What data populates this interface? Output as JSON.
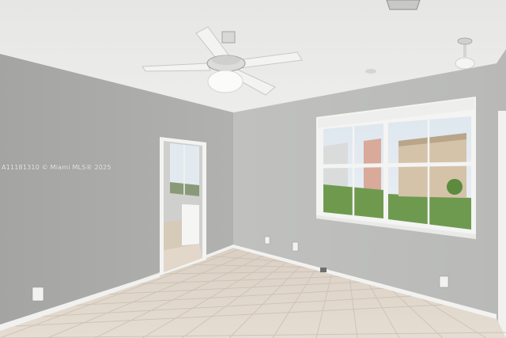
{
  "photo": {
    "watermark_text": "A11181310 © Miami MLS® 2025"
  },
  "colors": {
    "ceiling": "#e9e9e7",
    "left_wall": "#a9aaa8",
    "back_wall": "#c3c4c2",
    "right_wall": "#b5b6b4",
    "baseboard": "#f2f2f0",
    "floor_tile": "#ddd3c7",
    "grout": "#cfc3b5",
    "window_frame": "#f4f4f3",
    "door_trim": "#f3f3f2"
  }
}
